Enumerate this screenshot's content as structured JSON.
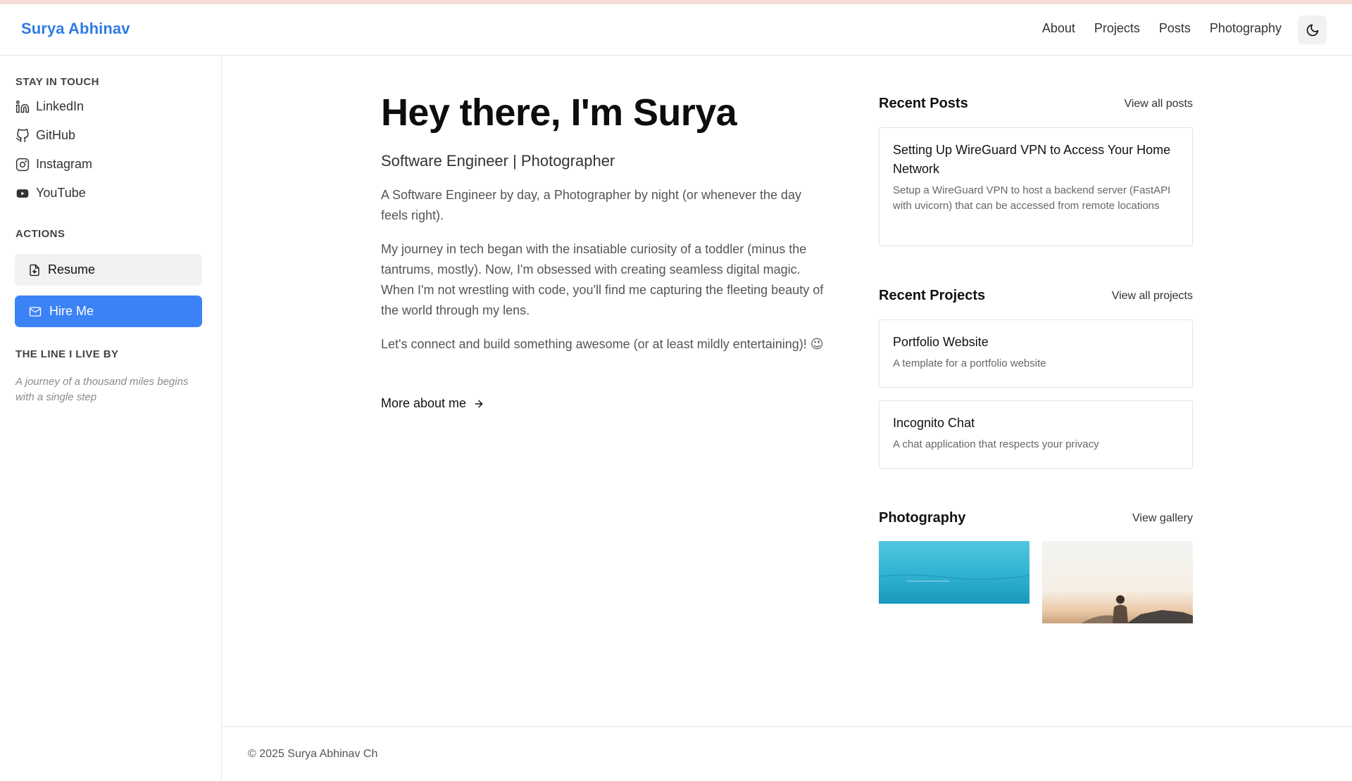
{
  "header": {
    "brand": "Surya Abhinav",
    "nav": [
      "About",
      "Projects",
      "Posts",
      "Photography"
    ]
  },
  "sidebar": {
    "stay_in_touch": "STAY IN TOUCH",
    "socials": [
      {
        "label": "LinkedIn",
        "icon": "linkedin-icon"
      },
      {
        "label": "GitHub",
        "icon": "github-icon"
      },
      {
        "label": "Instagram",
        "icon": "instagram-icon"
      },
      {
        "label": "YouTube",
        "icon": "youtube-icon"
      }
    ],
    "actions_heading": "ACTIONS",
    "resume_label": "Resume",
    "hire_label": "Hire Me",
    "line_heading": "THE LINE I LIVE BY",
    "quote": "A journey of a thousand miles begins with a single step"
  },
  "main": {
    "title": "Hey there, I'm Surya",
    "subtitle": "Software Engineer | Photographer",
    "paragraphs": [
      "A Software Engineer by day, a Photographer by night (or whenever the day feels right).",
      "My journey in tech began with the insatiable curiosity of a toddler (minus the tantrums, mostly). Now, I'm obsessed with creating seamless digital magic. When I'm not wrestling with code, you'll find me capturing the fleeting beauty of the world through my lens.",
      "Let's connect and build something awesome (or at least mildly entertaining)! 😉"
    ],
    "more_link": "More about me"
  },
  "recent_posts": {
    "title": "Recent Posts",
    "link": "View all posts",
    "items": [
      {
        "title": "Setting Up WireGuard VPN to Access Your Home Network",
        "desc": "Setup a WireGuard VPN to host a backend server (FastAPI with uvicorn) that can be accessed from remote locations"
      }
    ]
  },
  "recent_projects": {
    "title": "Recent Projects",
    "link": "View all projects",
    "items": [
      {
        "title": "Portfolio Website",
        "desc": "A template for a portfolio website"
      },
      {
        "title": "Incognito Chat",
        "desc": "A chat application that respects your privacy"
      }
    ]
  },
  "photography": {
    "title": "Photography",
    "link": "View gallery"
  },
  "footer": {
    "copyright": "© 2025 Surya Abhinav Ch"
  },
  "colors": {
    "accent": "#3b82f6",
    "brand": "#2f7be6"
  }
}
